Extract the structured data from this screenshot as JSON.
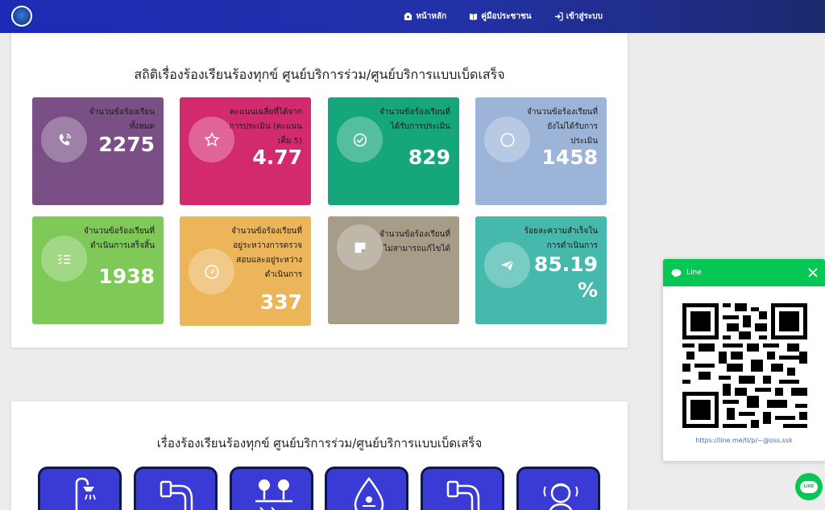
{
  "nav": {
    "home": "หน้าหลัก",
    "manual": "คู่มือประชาชน",
    "login": "เข้าสู่ระบบ"
  },
  "stats_title": "สถิติเรื่องร้องเรียนร้องทุกข์ ศูนย์บริการร่วม/ศูนย์บริการแบบเบ็ดเสร็จ",
  "stats": [
    {
      "label": "จำนวนข้อร้องเรียนทั้งหมด",
      "value": "2275",
      "icon": "phone-icon",
      "color": "#7a4f86"
    },
    {
      "label": "คะแนนเฉลี่ยที่ได้จากการประเมิน (คะแนนเต็ม 5)",
      "value": "4.77",
      "icon": "star-icon",
      "color": "#d22a6c"
    },
    {
      "label": "จำนวนข้อร้องเรียนที่ได้รับการประเมิน",
      "value": "829",
      "icon": "check-circle-icon",
      "color": "#15a67c"
    },
    {
      "label": "จำนวนข้อร้องเรียนที่ยังไม่ได้รับการประเมิน",
      "value": "1458",
      "icon": "circle-icon",
      "color": "#9cb4d8"
    },
    {
      "label": "จำนวนข้อร้องเรียนที่ดำเนินการเสร็จสิ้น",
      "value": "1938",
      "icon": "checklist-icon",
      "color": "#7ec957"
    },
    {
      "label": "จำนวนข้อร้องเรียนที่อยู่ระหว่างการตรวจสอบและอยู่ระหว่างดำเนินการ",
      "value": "337",
      "icon": "gauge-icon",
      "color": "#ecb55a"
    },
    {
      "label": "จำนวนข้อร้องเรียนที่ไม่สามารถแก้ไขได้",
      "value": "",
      "icon": "note-icon",
      "color": "#a79c88"
    },
    {
      "label": "ร้อยละความสำเร็จในการดำเนินการ",
      "value": "85.19 %",
      "icon": "send-icon",
      "color": "#45b9ac"
    }
  ],
  "services_title": "เรื่องร้องเรียนร้องทุกข์ ศูนย์บริการร่วม/ศูนย์บริการแบบเบ็ดเสร็จ",
  "services": [
    {
      "icon": "shower-icon"
    },
    {
      "icon": "pipe-icon"
    },
    {
      "icon": "trees-icon"
    },
    {
      "icon": "water-drop-icon"
    },
    {
      "icon": "faucet-icon"
    },
    {
      "icon": "person-speaking-icon"
    }
  ],
  "line_widget": {
    "title": "Line",
    "url": "https://line.me/ti/p/~@oss.ssk"
  },
  "line_fab": {
    "label": "LINE"
  }
}
